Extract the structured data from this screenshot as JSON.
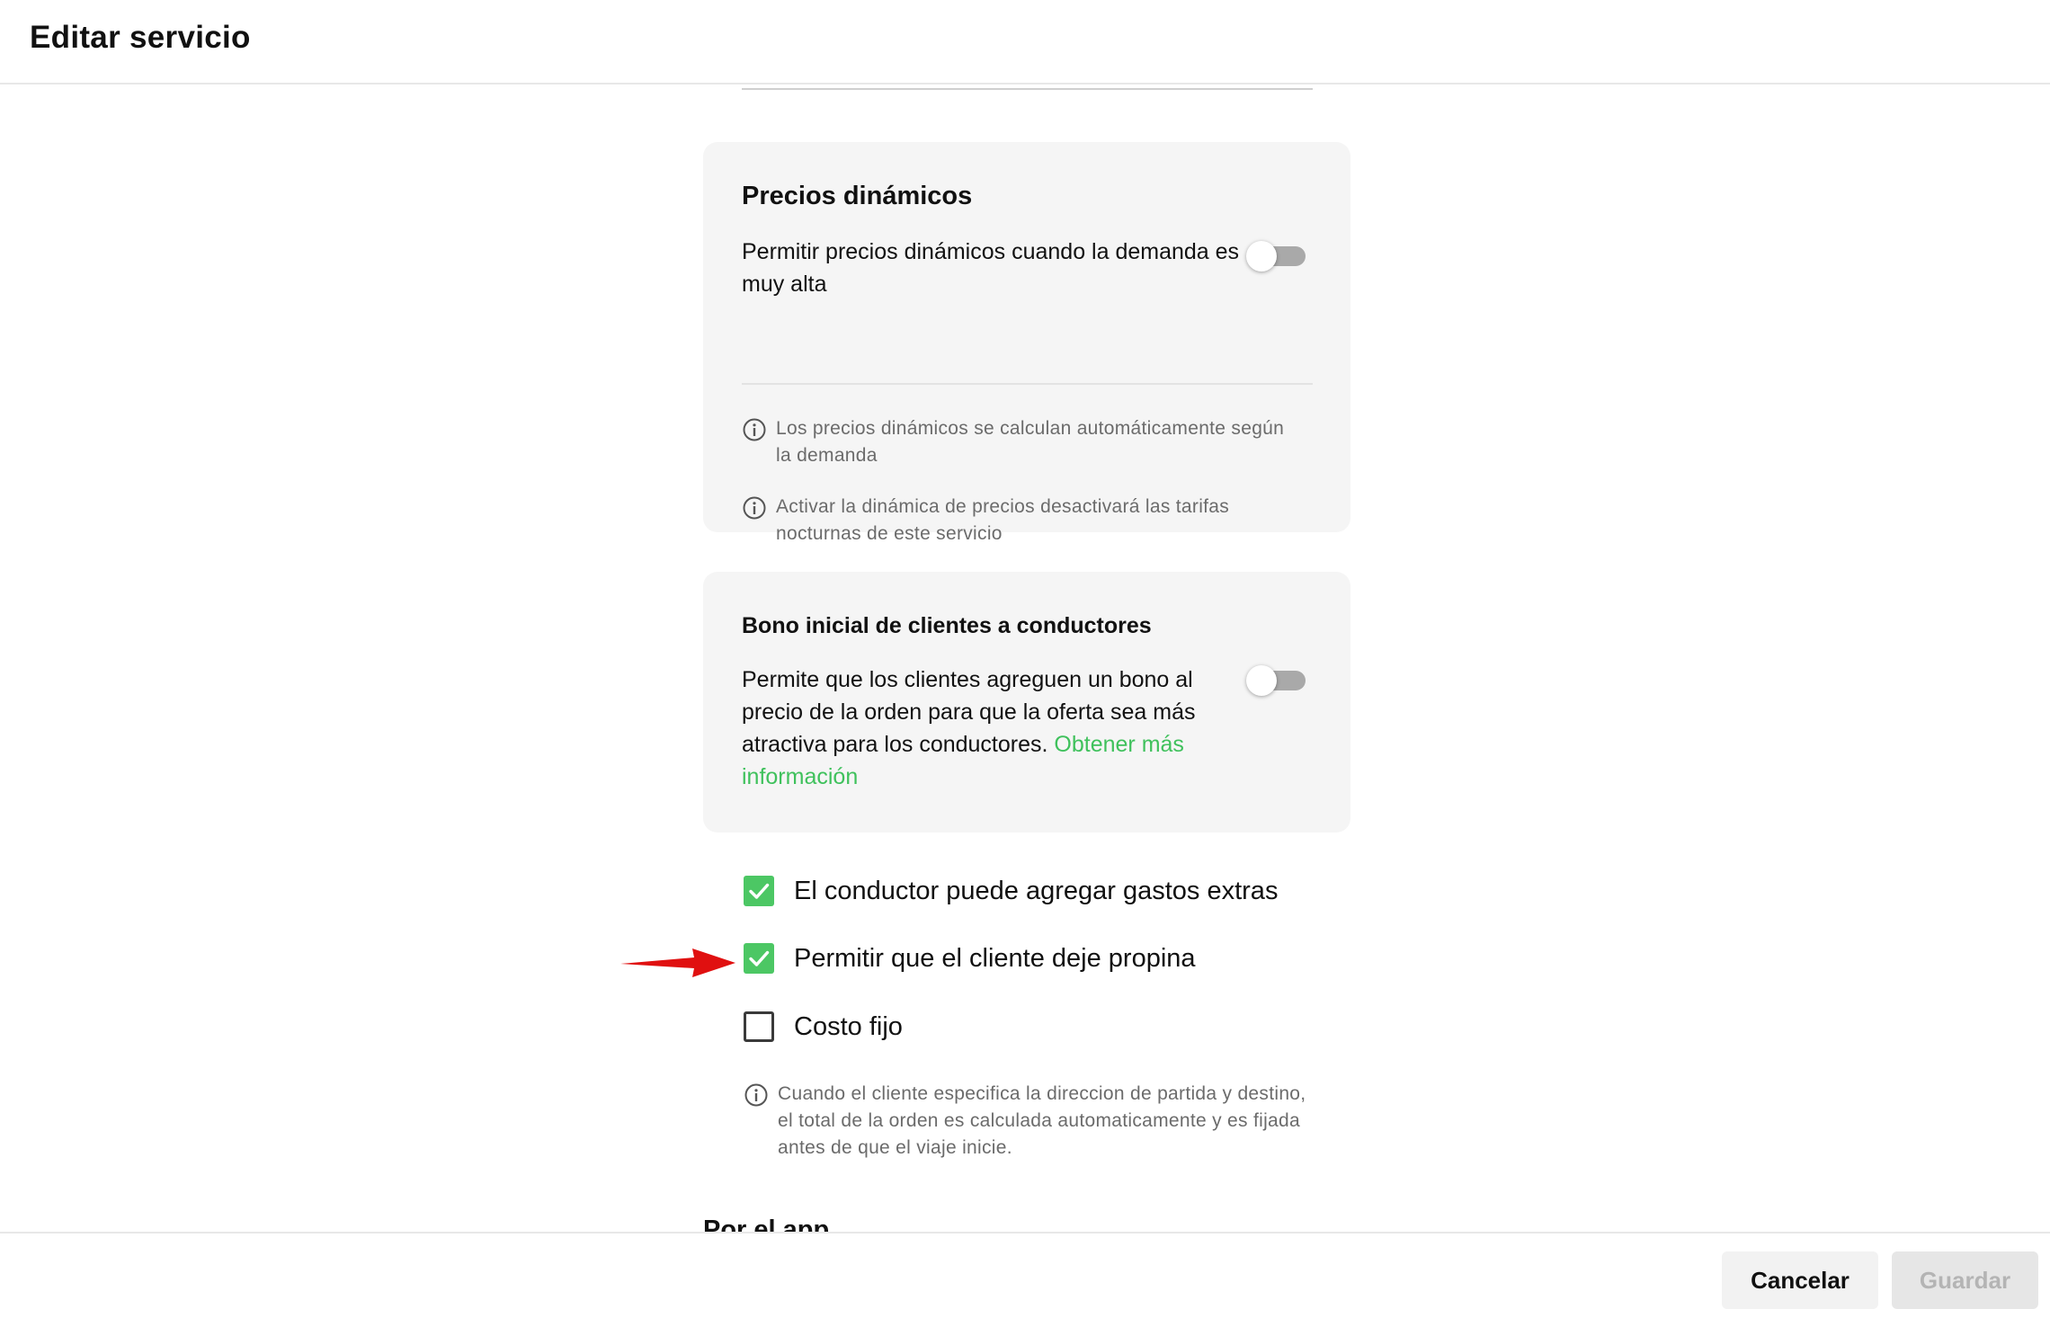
{
  "header": {
    "title": "Editar servicio"
  },
  "dynamic_pricing": {
    "title": "Precios dinámicos",
    "description": "Permitir precios dinámicos cuando la demanda es muy alta",
    "toggle_on": false,
    "info": [
      "Los precios dinámicos se calculan automáticamente según la demanda",
      "Activar la dinámica de precios desactivará las tarifas nocturnas de este servicio"
    ]
  },
  "bonus": {
    "title": "Bono inicial de clientes a conductores",
    "description": "Permite que los clientes agreguen un bono al precio de la orden para que la oferta sea más atractiva para los conductores.",
    "link": "Obtener más información",
    "toggle_on": false
  },
  "options": [
    {
      "label": "El conductor puede agregar gastos extras",
      "checked": true
    },
    {
      "label": "Permitir que el cliente deje propina",
      "checked": true
    },
    {
      "label": "Costo fijo",
      "checked": false
    }
  ],
  "fixed_cost_info": "Cuando el cliente especifica la direccion de partida y destino, el total de la orden es calculada automaticamente y es fijada antes de que el viaje inicie.",
  "next_section_title": "Por el app",
  "footer": {
    "cancel_label": "Cancelar",
    "save_label": "Guardar"
  },
  "colors": {
    "accent": "#4cc764",
    "link": "#3fc15c",
    "annotation_arrow": "#e01010"
  }
}
